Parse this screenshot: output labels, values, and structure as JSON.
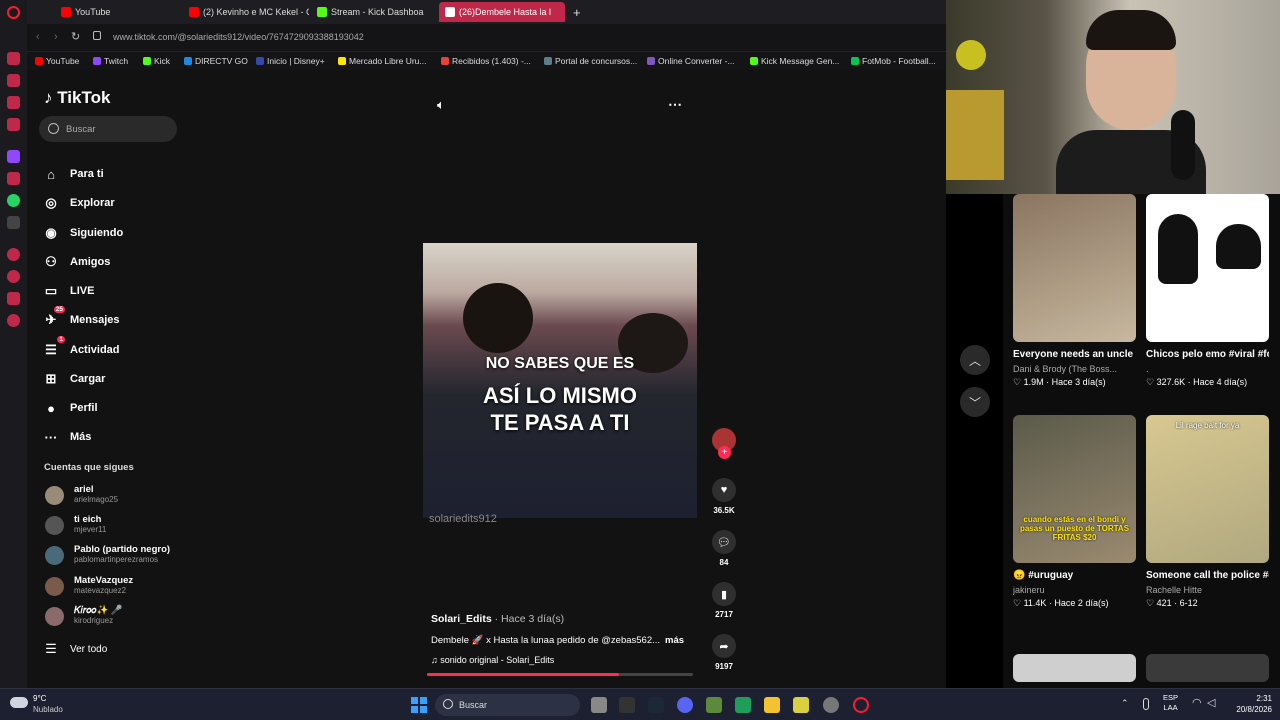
{
  "browser": {
    "tabs": [
      {
        "label": "YouTube",
        "favicon_color": "#ff0000"
      },
      {
        "label": "(2) Kevinho e MC Kekel - C",
        "favicon_color": "#ff0000"
      },
      {
        "label": "Stream - Kick Dashboa",
        "favicon_color": "#53fc18"
      },
      {
        "label": "(26)Dembele Hasta la l",
        "favicon_color": "#ffffff"
      }
    ],
    "new_tab": "+",
    "url": "www.tiktok.com/@solariedits912/video/7674729093388193042",
    "bookmarks": [
      {
        "label": "YouTube",
        "color": "#ff0000"
      },
      {
        "label": "Twitch",
        "color": "#9146ff"
      },
      {
        "label": "Kick",
        "color": "#53fc18"
      },
      {
        "label": "DIRECTV GO",
        "color": "#1e88e5"
      },
      {
        "label": "Inicio | Disney+",
        "color": "#3949ab"
      },
      {
        "label": "Mercado Libre Uru...",
        "color": "#ffe600"
      },
      {
        "label": "Recibidos (1.403) -...",
        "color": "#ea4335"
      },
      {
        "label": "Portal de concursos...",
        "color": "#607d8b"
      },
      {
        "label": "Online Converter -...",
        "color": "#7e57c2"
      },
      {
        "label": "Kick Message Gen...",
        "color": "#53fc18"
      },
      {
        "label": "FotMob - Football...",
        "color": "#00c853"
      }
    ]
  },
  "tiktok": {
    "logo": "TikTok",
    "search_placeholder": "Buscar",
    "nav": [
      {
        "label": "Para ti",
        "icon": "home-icon",
        "glyph": "⌂",
        "badge": ""
      },
      {
        "label": "Explorar",
        "icon": "compass-icon",
        "glyph": "◎",
        "badge": ""
      },
      {
        "label": "Siguiendo",
        "icon": "following-icon",
        "glyph": "◉",
        "badge": ""
      },
      {
        "label": "Amigos",
        "icon": "friends-icon",
        "glyph": "⚇",
        "badge": ""
      },
      {
        "label": "LIVE",
        "icon": "live-icon",
        "glyph": "▭",
        "badge": ""
      },
      {
        "label": "Mensajes",
        "icon": "messages-icon",
        "glyph": "✈",
        "badge": "25"
      },
      {
        "label": "Actividad",
        "icon": "activity-icon",
        "glyph": "☰",
        "badge": "1"
      },
      {
        "label": "Cargar",
        "icon": "upload-icon",
        "glyph": "⊞",
        "badge": ""
      },
      {
        "label": "Perfil",
        "icon": "profile-icon",
        "glyph": "●",
        "badge": ""
      },
      {
        "label": "Más",
        "icon": "more-icon",
        "glyph": "···",
        "badge": ""
      }
    ],
    "following_title": "Cuentas que sigues",
    "following": [
      {
        "name": "ariel",
        "handle": "arielmago25",
        "color": "#9a8a7a"
      },
      {
        "name": "ti eich",
        "handle": "mjever11",
        "color": "#555"
      },
      {
        "name": "Pablo (partido negro)",
        "handle": "pablomartinperezramos",
        "color": "#4a6a7a"
      },
      {
        "name": "MateVazquez",
        "handle": "matevazquez2",
        "color": "#7a5a4a"
      },
      {
        "name": "𝐾𝑖𝑟𝑜𝑜✨ 🎤",
        "handle": "kirodriguez",
        "color": "#8a6a6a"
      }
    ],
    "see_all": "Ver todo",
    "video": {
      "overlay_lines": [
        "NO SABES QUE ES",
        "ASÍ LO MISMO",
        "TE PASA A TI"
      ],
      "watermark": "solariedits912",
      "author": "Solari_Edits",
      "time": "· Hace 3 día(s)",
      "description": "Dembele 🚀 x Hasta la lunaa pedido de @zebas562...",
      "more": "más",
      "sound": "♫  sonido original - Solari_Edits",
      "likes": "36.5K",
      "comments": "84",
      "saves": "2717",
      "shares": "9197",
      "progress": 0.72
    }
  },
  "grid": [
    {
      "title": "Everyone needs an uncle Joe! #family",
      "author": "Dani & Brody (The Boss...",
      "likes": "♡ 1.9M",
      "when": "Hace 3 día(s)",
      "colors": [
        "#8a7560",
        "#c8b8a0"
      ]
    },
    {
      "title": "Chicos pelo emo #viral #foryou #anime...",
      "author": ".",
      "likes": "♡ 327.6K",
      "when": "Hace 4 día(s)",
      "colors": [
        "#ffffff",
        "#f0f0f0"
      ]
    },
    {
      "title": "😠 #uruguay",
      "author": "jakineru",
      "likes": "♡ 11.4K",
      "when": "Hace 2 día(s)",
      "colors": [
        "#5a5a4a",
        "#9a8a70"
      ]
    },
    {
      "title": "Someone call the police #quesoqueen #queso...",
      "author": "Rachelle Hitte",
      "likes": "♡ 421",
      "when": "6-12",
      "colors": [
        "#d8c890",
        "#b0a880"
      ]
    }
  ],
  "grid_overlays": [
    "cuando estás en el bondi y pasas un puesto de TORTAS FRITAS $20",
    "Lil rage bait for ya"
  ],
  "taskbar": {
    "weather_temp": "9°C",
    "weather_desc": "Nublado",
    "search": "Buscar",
    "lang1": "ESP",
    "lang2": "LAA",
    "time": "2:31",
    "date": "20/8/2026"
  }
}
